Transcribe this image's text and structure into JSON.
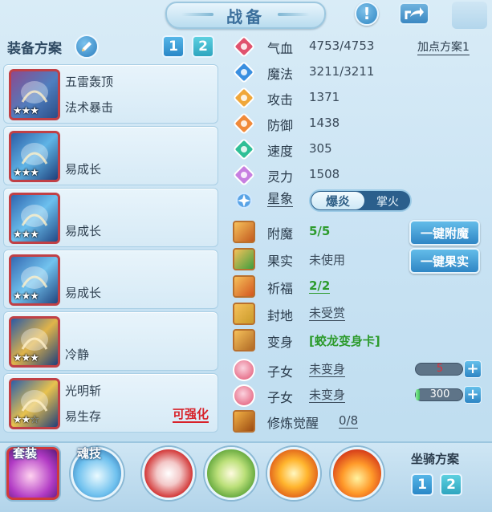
{
  "header": {
    "title": "战备",
    "help_icon": "exclamation-icon",
    "share_icon": "share-arrow-icon"
  },
  "equipment_scheme": {
    "label": "装备方案",
    "edit_icon": "pencil-icon",
    "tabs": [
      "1",
      "2"
    ],
    "items": [
      {
        "line1": "五雷轰顶",
        "line2": "法术暴击",
        "stars_filled": 3,
        "stars_total": 3,
        "upgrade": ""
      },
      {
        "line1": "",
        "line2": "易成长",
        "stars_filled": 3,
        "stars_total": 3,
        "upgrade": ""
      },
      {
        "line1": "",
        "line2": "易成长",
        "stars_filled": 3,
        "stars_total": 3,
        "upgrade": ""
      },
      {
        "line1": "",
        "line2": "易成长",
        "stars_filled": 3,
        "stars_total": 3,
        "upgrade": ""
      },
      {
        "line1": "",
        "line2": "冷静",
        "stars_filled": 3,
        "stars_total": 3,
        "upgrade": ""
      },
      {
        "line1": "光明斩",
        "line2": "易生存",
        "stars_filled": 2,
        "stars_total": 3,
        "upgrade": "可强化"
      }
    ]
  },
  "stats": {
    "addpoint_label": "加点方案1",
    "rows": [
      {
        "name": "气血",
        "value": "4753/4753",
        "icon": "heart-icon",
        "color": "#e0526e"
      },
      {
        "name": "魔法",
        "value": "3211/3211",
        "icon": "mana-icon",
        "color": "#3a8fe0"
      },
      {
        "name": "攻击",
        "value": "1371",
        "icon": "sword-icon",
        "color": "#f0a73a"
      },
      {
        "name": "防御",
        "value": "1438",
        "icon": "shield-icon",
        "color": "#f08a3a"
      },
      {
        "name": "速度",
        "value": "305",
        "icon": "speed-icon",
        "color": "#2fbf96"
      },
      {
        "name": "灵力",
        "value": "1508",
        "icon": "spirit-icon",
        "color": "#c77fe0"
      }
    ],
    "star_sign": {
      "name": "星象",
      "icon": "star-sign-icon",
      "options": [
        "爆炎",
        "掌火"
      ],
      "selected": "爆炎"
    }
  },
  "extras": [
    {
      "name": "附魔",
      "value": "5/5",
      "icon": "enchant-icon",
      "green": true,
      "underline": false
    },
    {
      "name": "果实",
      "value": "未使用",
      "icon": "fruit-icon",
      "green": false,
      "underline": false
    },
    {
      "name": "祈福",
      "value": "2/2",
      "icon": "blessing-icon",
      "green": true,
      "underline": true
    },
    {
      "name": "封地",
      "value": "未受赏",
      "icon": "fief-icon",
      "green": false,
      "underline": true
    },
    {
      "name": "变身",
      "value": "[蛟龙变身卡]",
      "icon": "transform-icon",
      "green": true,
      "underline": false
    }
  ],
  "buttons": {
    "enchant": "一键附魔",
    "fruit": "一键果实"
  },
  "children": [
    {
      "name": "子女",
      "value": "未变身",
      "icon": "child-icon-1",
      "slider_value": "5",
      "slider_color": "#e0303a",
      "fill_pct": 0
    },
    {
      "name": "子女",
      "value": "未变身",
      "icon": "child-icon-2",
      "slider_value": "300",
      "slider_color": "#ffffff",
      "fill_pct": 8
    }
  ],
  "cultivation": {
    "name": "修炼觉醒",
    "value": "0/8",
    "icon": "cultivation-icon"
  },
  "bottom": {
    "skills": [
      {
        "label": "套装",
        "icon": "suit-hand-icon"
      },
      {
        "label": "魂技",
        "icon": "soul-skill-icon"
      },
      {
        "label": "",
        "icon": "red-blade-icon"
      },
      {
        "label": "",
        "icon": "green-spirit-icon"
      },
      {
        "label": "",
        "icon": "fire-orb-icon"
      },
      {
        "label": "",
        "icon": "flame-icon"
      }
    ],
    "mount_label": "坐骑方案",
    "mount_tabs": [
      "1",
      "2"
    ]
  }
}
